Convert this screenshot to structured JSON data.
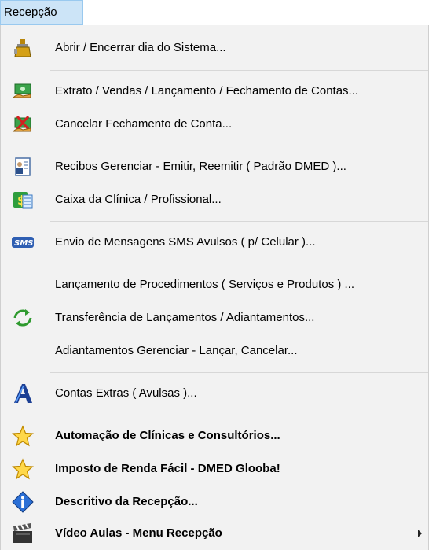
{
  "menubar": {
    "title": "Recepção"
  },
  "items": [
    {
      "label": "Abrir / Encerrar dia do Sistema...",
      "icon": "gear-oil-can-icon"
    },
    {
      "label": "Extrato / Vendas / Lançamento / Fechamento de Contas...",
      "icon": "money-hand-icon"
    },
    {
      "label": "Cancelar Fechamento de Conta...",
      "icon": "money-cancel-icon"
    },
    {
      "label": "Recibos Gerenciar - Emitir, Reemitir ( Padrão DMED )...",
      "icon": "receipt-icon"
    },
    {
      "label": "Caixa da Clínica / Profissional...",
      "icon": "cash-register-icon"
    },
    {
      "label": "Envio de Mensagens SMS Avulsos ( p/ Celular )...",
      "icon": "sms-icon"
    },
    {
      "label": "Lançamento de Procedimentos ( Serviços e Produtos ) ...",
      "icon": ""
    },
    {
      "label": "Transferência de Lançamentos / Adiantamentos...",
      "icon": "transfer-arrows-icon"
    },
    {
      "label": "Adiantamentos Gerenciar - Lançar, Cancelar...",
      "icon": ""
    },
    {
      "label": "Contas Extras ( Avulsas )...",
      "icon": "letter-a-icon"
    },
    {
      "label": "Automação de Clínicas e Consultórios...",
      "icon": "star-icon"
    },
    {
      "label": "Imposto de Renda Fácil - DMED Glooba!",
      "icon": "star-icon"
    },
    {
      "label": "Descritivo da Recepção...",
      "icon": "info-icon"
    },
    {
      "label": "Vídeo Aulas - Menu Recepção",
      "icon": "clapperboard-icon"
    }
  ],
  "colors": {
    "highlight": "#cce4f7",
    "menu_bg": "#f2f2f2",
    "separator": "#d7d7d7"
  }
}
